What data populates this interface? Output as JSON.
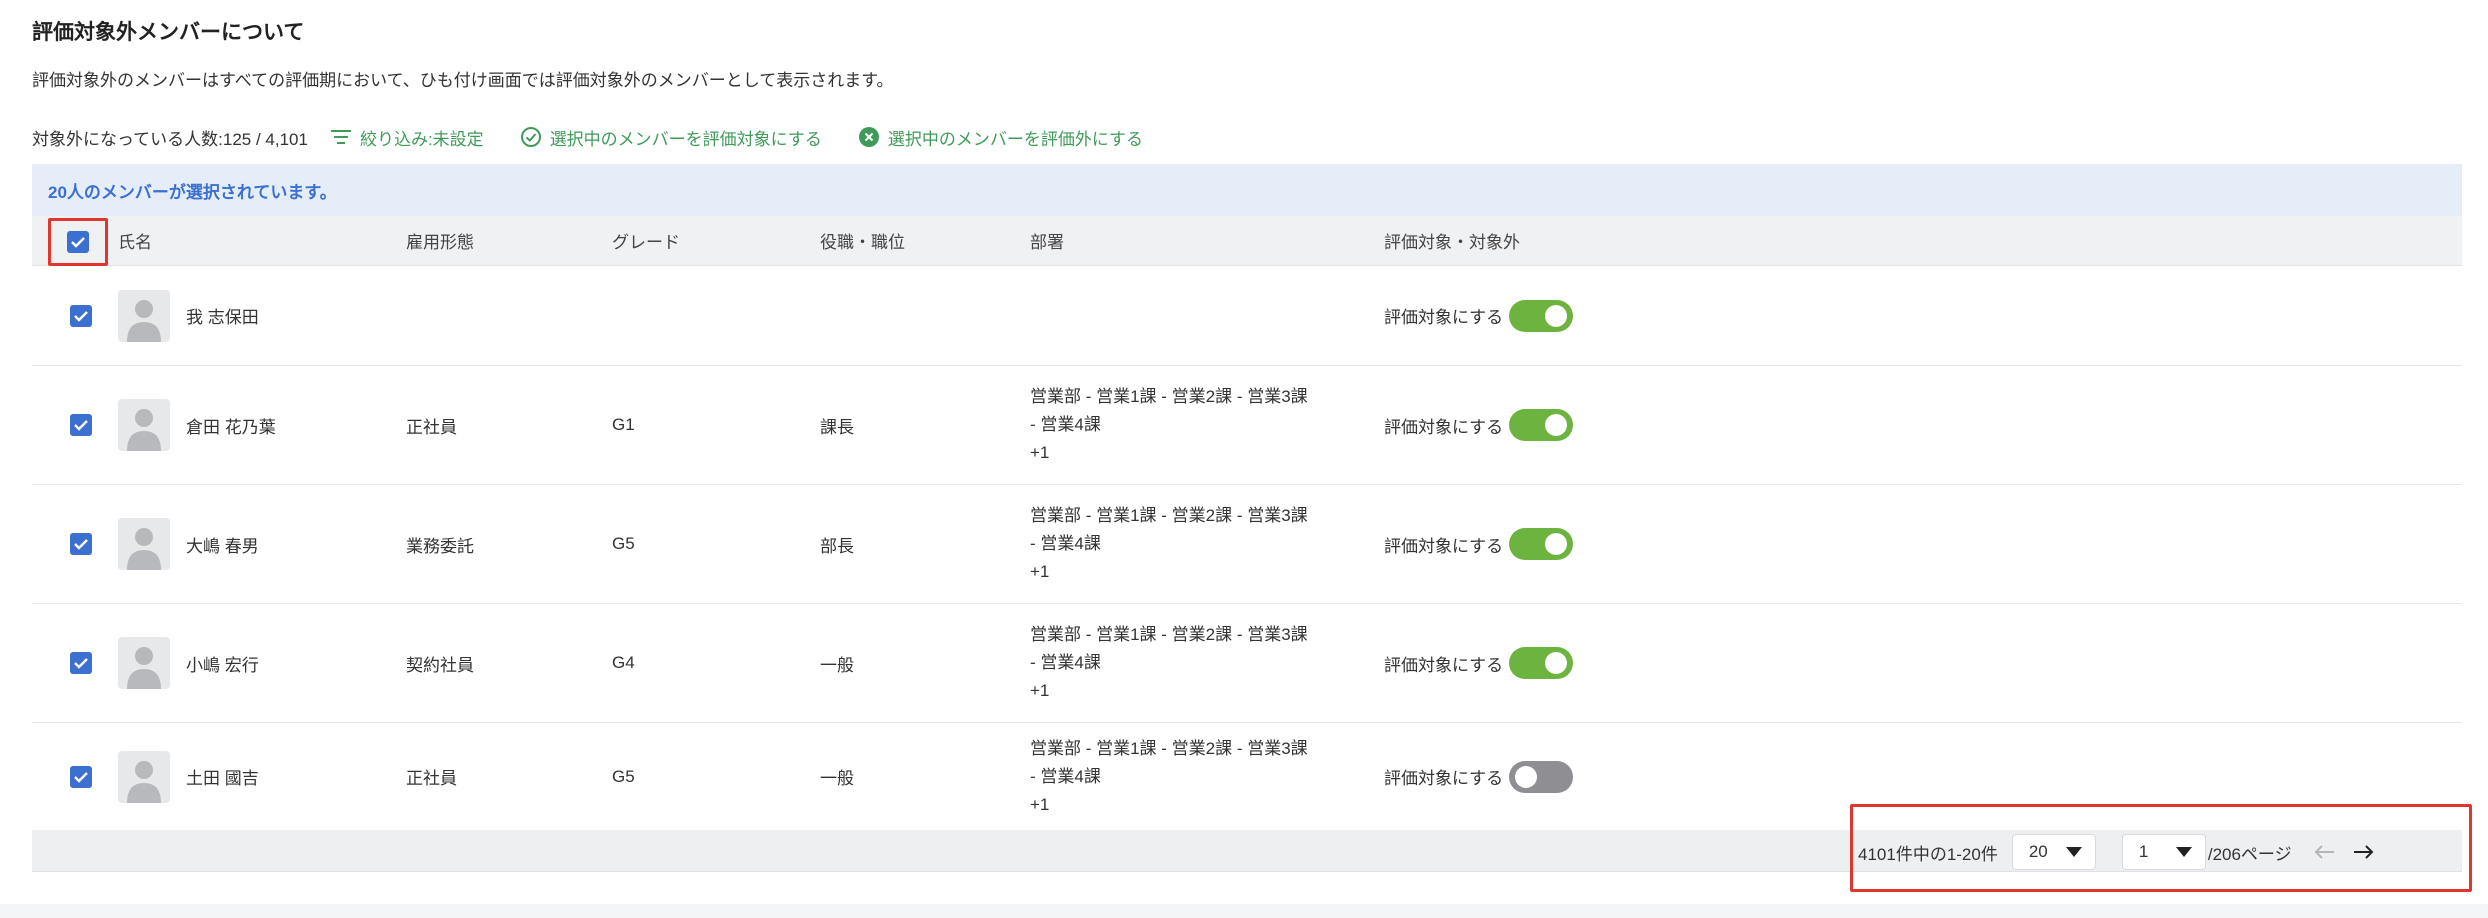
{
  "title": "評価対象外メンバーについて",
  "description": "評価対象外のメンバーはすべての評価期において、ひも付け画面では評価対象外のメンバーとして表示されます。",
  "toolbar": {
    "count_text": "対象外になっている人数:125 / 4,101",
    "filter_label": "絞り込み:未設定",
    "include_label": "選択中のメンバーを評価対象にする",
    "exclude_label": "選択中のメンバーを評価外にする"
  },
  "selection_banner": "20人のメンバーが選択されています。",
  "columns": {
    "name": "氏名",
    "employment": "雇用形態",
    "grade": "グレード",
    "position": "役職・職位",
    "department": "部署",
    "evaluation": "評価対象・対象外"
  },
  "rows": [
    {
      "name": "我 志保田",
      "employment": "",
      "grade": "",
      "position": "",
      "dept_line1": "",
      "dept_line2": "",
      "dept_more": "",
      "toggle_label": "評価対象にする",
      "toggle_on": true
    },
    {
      "name": "倉田 花乃葉",
      "employment": "正社員",
      "grade": "G1",
      "position": "課長",
      "dept_line1": "営業部 - 営業1課 - 営業2課 - 営業3課",
      "dept_line2": "- 営業4課",
      "dept_more": "+1",
      "toggle_label": "評価対象にする",
      "toggle_on": true
    },
    {
      "name": "大嶋 春男",
      "employment": "業務委託",
      "grade": "G5",
      "position": "部長",
      "dept_line1": "営業部 - 営業1課 - 営業2課 - 営業3課",
      "dept_line2": "- 営業4課",
      "dept_more": "+1",
      "toggle_label": "評価対象にする",
      "toggle_on": true
    },
    {
      "name": "小嶋 宏行",
      "employment": "契約社員",
      "grade": "G4",
      "position": "一般",
      "dept_line1": "営業部 - 営業1課 - 営業2課 - 営業3課",
      "dept_line2": "- 営業4課",
      "dept_more": "+1",
      "toggle_label": "評価対象にする",
      "toggle_on": true
    },
    {
      "name": "土田 國吉",
      "employment": "正社員",
      "grade": "G5",
      "position": "一般",
      "dept_line1": "営業部 - 営業1課 - 営業2課 - 営業3課",
      "dept_line2": "- 営業4課",
      "dept_more": "+1",
      "toggle_label": "評価対象にする",
      "toggle_on": false
    }
  ],
  "pager": {
    "range_text": "4101件中の1-20件",
    "per_page": "20",
    "current_page": "1",
    "total_pages_text": "/206ページ"
  },
  "colors": {
    "accent_blue": "#3b6fd0",
    "action_green": "#3f9b5a",
    "toggle_on": "#6db33f",
    "toggle_off": "#8e8e93",
    "highlight_red": "#e0362c"
  }
}
